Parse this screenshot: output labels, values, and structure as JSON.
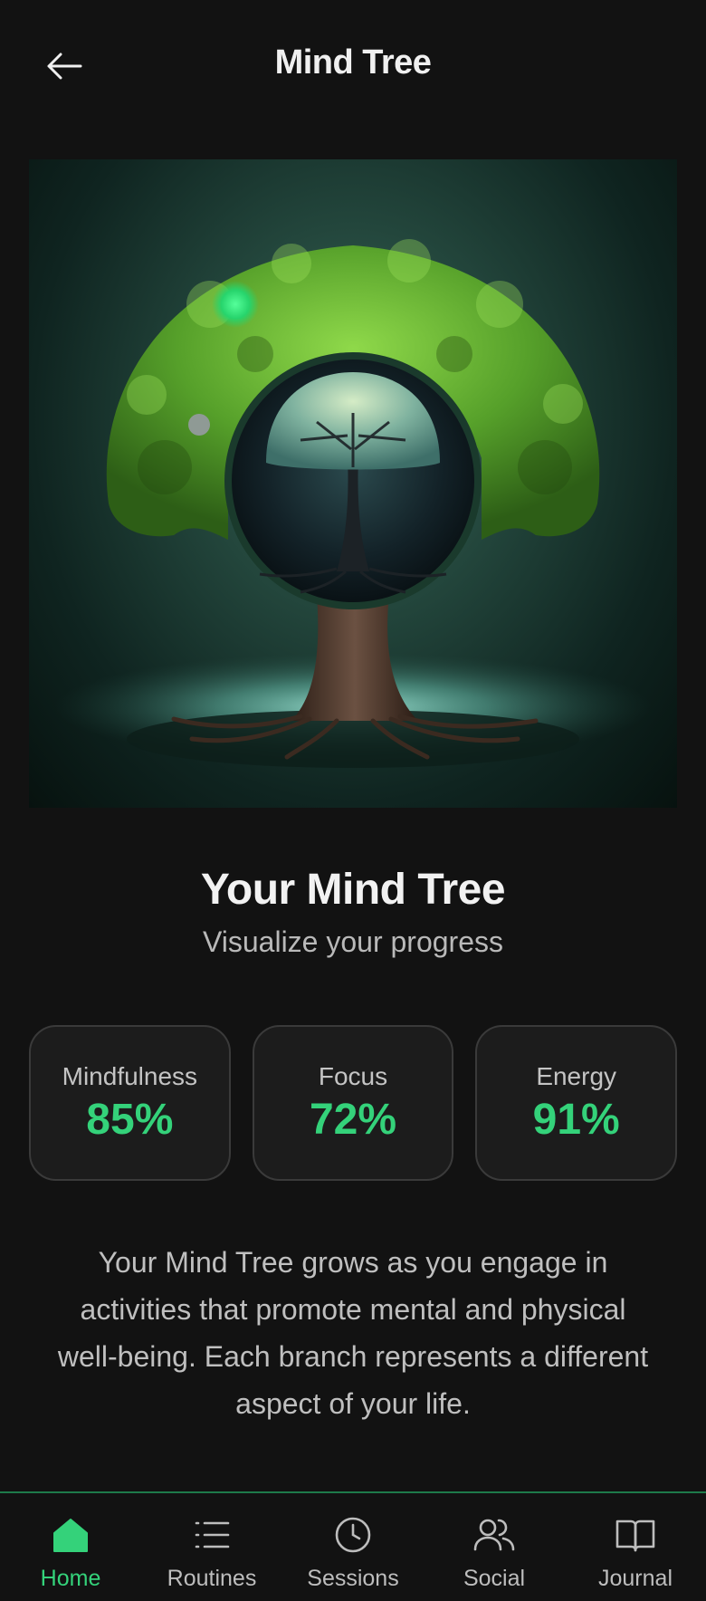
{
  "header": {
    "title": "Mind Tree",
    "back_icon": "arrow-left-icon"
  },
  "hero": {
    "image": "mind-tree-illustration"
  },
  "main": {
    "heading": "Your Mind Tree",
    "subheading": "Visualize your progress"
  },
  "stats": [
    {
      "label": "Mindfulness",
      "value": "85%"
    },
    {
      "label": "Focus",
      "value": "72%"
    },
    {
      "label": "Energy",
      "value": "91%"
    }
  ],
  "description": "Your Mind Tree grows as you engage in activities that promote mental and physical well-being. Each branch represents a different aspect of your life.",
  "nav": {
    "items": [
      {
        "label": "Home",
        "icon": "home-icon",
        "active": true
      },
      {
        "label": "Routines",
        "icon": "list-icon",
        "active": false
      },
      {
        "label": "Sessions",
        "icon": "clock-icon",
        "active": false
      },
      {
        "label": "Social",
        "icon": "users-icon",
        "active": false
      },
      {
        "label": "Journal",
        "icon": "book-icon",
        "active": false
      }
    ]
  },
  "colors": {
    "accent": "#34d27a",
    "background": "#121212",
    "card": "#1c1c1c"
  }
}
